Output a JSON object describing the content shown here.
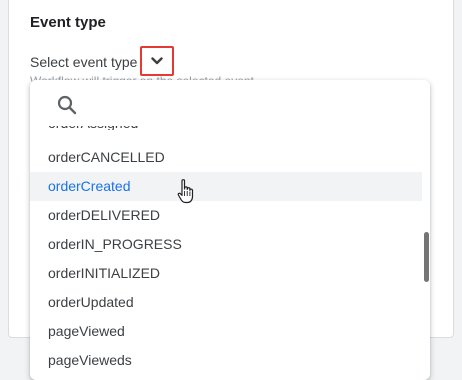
{
  "section": {
    "title": "Event type"
  },
  "select": {
    "label": "Select event type",
    "helper_text": "Workflow will trigger on the selected event"
  },
  "search": {
    "placeholder": ""
  },
  "dropdown": {
    "cut_item": "orderAssigned",
    "items": [
      "orderCANCELLED",
      "orderCreated",
      "orderDELIVERED",
      "orderIN_PROGRESS",
      "orderINITIALIZED",
      "orderUpdated",
      "pageViewed",
      "pageVieweds"
    ],
    "highlighted_item": "orderCreated"
  },
  "colors": {
    "accent": "#1a73e8",
    "highlight_bg": "#f1f3f4",
    "annotation_border": "#e53935"
  },
  "icons": {
    "search": "search-icon",
    "chevron": "chevron-down-icon",
    "cursor": "hand-pointer-icon"
  }
}
